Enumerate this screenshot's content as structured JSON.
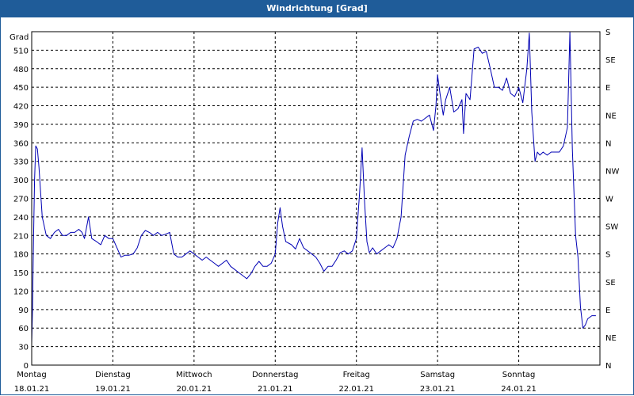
{
  "window": {
    "title": "Windrichtung [Grad]"
  },
  "chart_data": {
    "type": "line",
    "title": "Windrichtung [Grad]",
    "ylabel": "Grad",
    "ylim": [
      0,
      540
    ],
    "yticks": [
      0,
      30,
      60,
      90,
      120,
      150,
      180,
      210,
      240,
      270,
      300,
      330,
      360,
      390,
      420,
      450,
      480,
      510
    ],
    "right_axis_labels": [
      "N",
      "NE",
      "E",
      "SE",
      "S",
      "SW",
      "W",
      "NW",
      "N",
      "NE",
      "E",
      "SE",
      "S"
    ],
    "xlim": [
      0,
      7
    ],
    "x_ticks": [
      {
        "day": "Montag",
        "date": "18.01.21"
      },
      {
        "day": "Dienstag",
        "date": "19.01.21"
      },
      {
        "day": "Mittwoch",
        "date": "20.01.21"
      },
      {
        "day": "Donnerstag",
        "date": "21.01.21"
      },
      {
        "day": "Freitag",
        "date": "22.01.21"
      },
      {
        "day": "Samstag",
        "date": "23.01.21"
      },
      {
        "day": "Sonntag",
        "date": "24.01.21"
      }
    ],
    "grid": true,
    "series": [
      {
        "color": "#0000b4",
        "points": [
          [
            0.0,
            35
          ],
          [
            0.01,
            90
          ],
          [
            0.02,
            180
          ],
          [
            0.035,
            300
          ],
          [
            0.05,
            355
          ],
          [
            0.07,
            350
          ],
          [
            0.09,
            320
          ],
          [
            0.13,
            240
          ],
          [
            0.18,
            210
          ],
          [
            0.23,
            205
          ],
          [
            0.28,
            215
          ],
          [
            0.33,
            220
          ],
          [
            0.38,
            210
          ],
          [
            0.43,
            210
          ],
          [
            0.48,
            215
          ],
          [
            0.53,
            215
          ],
          [
            0.58,
            220
          ],
          [
            0.62,
            215
          ],
          [
            0.65,
            205
          ],
          [
            0.7,
            240
          ],
          [
            0.74,
            205
          ],
          [
            0.8,
            200
          ],
          [
            0.85,
            195
          ],
          [
            0.9,
            210
          ],
          [
            0.95,
            205
          ],
          [
            1.0,
            205
          ],
          [
            1.05,
            190
          ],
          [
            1.1,
            175
          ],
          [
            1.15,
            178
          ],
          [
            1.2,
            178
          ],
          [
            1.25,
            180
          ],
          [
            1.3,
            190
          ],
          [
            1.35,
            210
          ],
          [
            1.4,
            218
          ],
          [
            1.45,
            215
          ],
          [
            1.5,
            210
          ],
          [
            1.55,
            215
          ],
          [
            1.6,
            210
          ],
          [
            1.65,
            212
          ],
          [
            1.7,
            215
          ],
          [
            1.75,
            180
          ],
          [
            1.8,
            175
          ],
          [
            1.85,
            175
          ],
          [
            1.9,
            180
          ],
          [
            1.95,
            185
          ],
          [
            2.0,
            180
          ],
          [
            2.05,
            175
          ],
          [
            2.1,
            170
          ],
          [
            2.15,
            175
          ],
          [
            2.2,
            170
          ],
          [
            2.25,
            165
          ],
          [
            2.3,
            160
          ],
          [
            2.35,
            165
          ],
          [
            2.4,
            170
          ],
          [
            2.45,
            160
          ],
          [
            2.5,
            155
          ],
          [
            2.55,
            150
          ],
          [
            2.6,
            145
          ],
          [
            2.65,
            140
          ],
          [
            2.7,
            148
          ],
          [
            2.75,
            160
          ],
          [
            2.8,
            168
          ],
          [
            2.85,
            160
          ],
          [
            2.9,
            160
          ],
          [
            2.95,
            165
          ],
          [
            3.0,
            180
          ],
          [
            3.03,
            230
          ],
          [
            3.06,
            255
          ],
          [
            3.09,
            225
          ],
          [
            3.13,
            200
          ],
          [
            3.2,
            195
          ],
          [
            3.25,
            188
          ],
          [
            3.3,
            205
          ],
          [
            3.35,
            190
          ],
          [
            3.4,
            185
          ],
          [
            3.45,
            180
          ],
          [
            3.5,
            175
          ],
          [
            3.55,
            165
          ],
          [
            3.6,
            152
          ],
          [
            3.65,
            160
          ],
          [
            3.7,
            160
          ],
          [
            3.75,
            170
          ],
          [
            3.8,
            182
          ],
          [
            3.85,
            185
          ],
          [
            3.9,
            180
          ],
          [
            3.95,
            185
          ],
          [
            4.0,
            205
          ],
          [
            4.04,
            280
          ],
          [
            4.07,
            352
          ],
          [
            4.1,
            265
          ],
          [
            4.13,
            200
          ],
          [
            4.16,
            182
          ],
          [
            4.2,
            190
          ],
          [
            4.25,
            180
          ],
          [
            4.3,
            185
          ],
          [
            4.35,
            190
          ],
          [
            4.4,
            195
          ],
          [
            4.45,
            190
          ],
          [
            4.5,
            205
          ],
          [
            4.55,
            240
          ],
          [
            4.6,
            340
          ],
          [
            4.65,
            370
          ],
          [
            4.7,
            395
          ],
          [
            4.75,
            398
          ],
          [
            4.8,
            395
          ],
          [
            4.85,
            400
          ],
          [
            4.9,
            405
          ],
          [
            4.95,
            380
          ],
          [
            4.98,
            420
          ],
          [
            5.0,
            470
          ],
          [
            5.03,
            440
          ],
          [
            5.07,
            405
          ],
          [
            5.1,
            430
          ],
          [
            5.15,
            450
          ],
          [
            5.2,
            410
          ],
          [
            5.25,
            415
          ],
          [
            5.3,
            430
          ],
          [
            5.32,
            375
          ],
          [
            5.35,
            440
          ],
          [
            5.4,
            430
          ],
          [
            5.45,
            512
          ],
          [
            5.5,
            515
          ],
          [
            5.55,
            505
          ],
          [
            5.6,
            508
          ],
          [
            5.65,
            480
          ],
          [
            5.7,
            450
          ],
          [
            5.75,
            450
          ],
          [
            5.8,
            445
          ],
          [
            5.85,
            465
          ],
          [
            5.9,
            440
          ],
          [
            5.95,
            435
          ],
          [
            6.0,
            450
          ],
          [
            6.05,
            425
          ],
          [
            6.1,
            480
          ],
          [
            6.13,
            538
          ],
          [
            6.16,
            410
          ],
          [
            6.2,
            330
          ],
          [
            6.23,
            345
          ],
          [
            6.26,
            340
          ],
          [
            6.3,
            345
          ],
          [
            6.35,
            340
          ],
          [
            6.4,
            345
          ],
          [
            6.45,
            345
          ],
          [
            6.5,
            345
          ],
          [
            6.55,
            355
          ],
          [
            6.6,
            385
          ],
          [
            6.63,
            540
          ],
          [
            6.66,
            350
          ],
          [
            6.7,
            210
          ],
          [
            6.73,
            175
          ],
          [
            6.76,
            95
          ],
          [
            6.79,
            60
          ],
          [
            6.82,
            65
          ],
          [
            6.85,
            75
          ],
          [
            6.9,
            80
          ],
          [
            6.95,
            80
          ]
        ]
      }
    ]
  }
}
